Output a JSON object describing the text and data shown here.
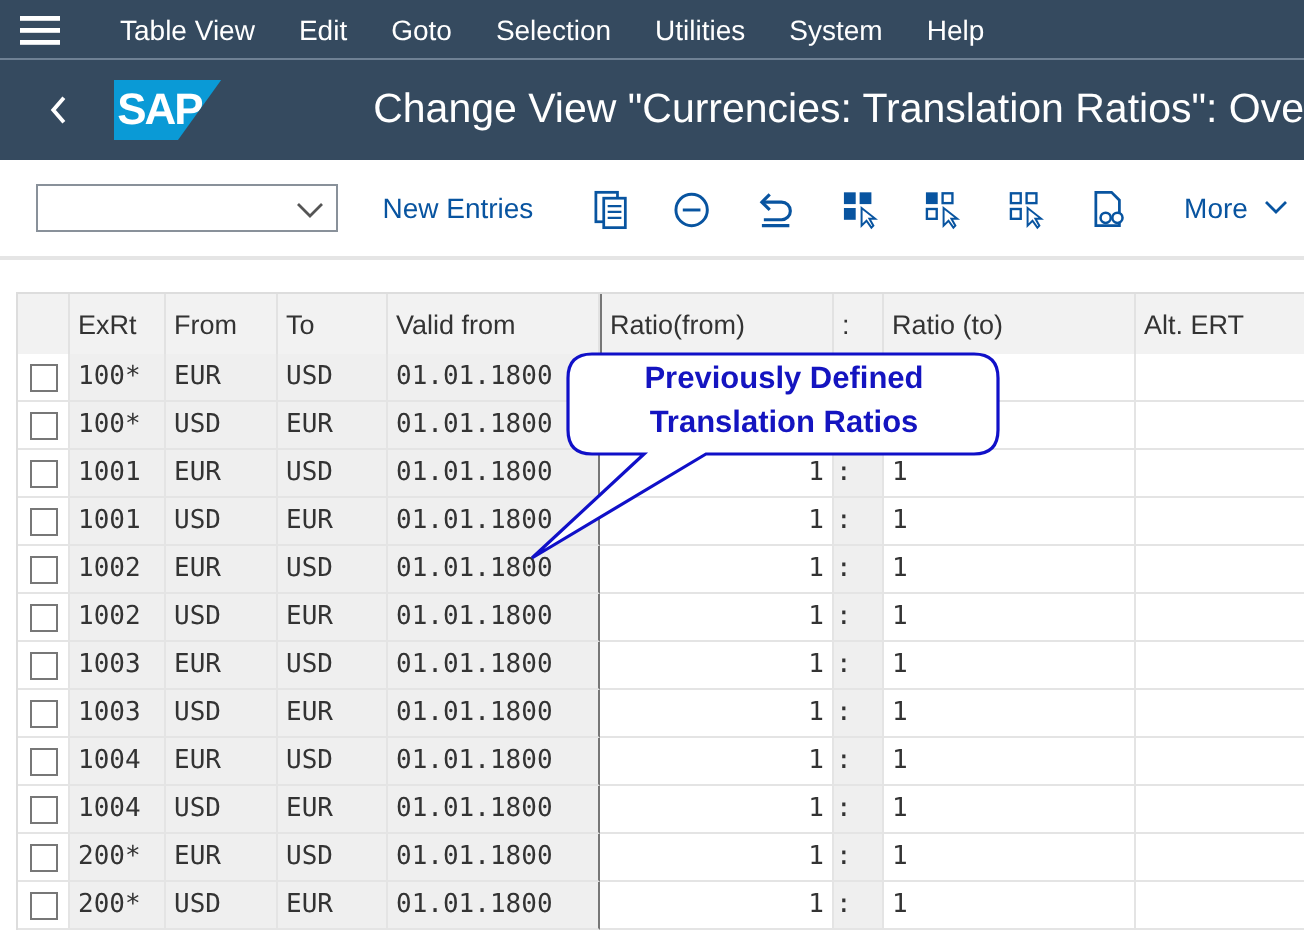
{
  "menu": [
    "Table View",
    "Edit",
    "Goto",
    "Selection",
    "Utilities",
    "System",
    "Help"
  ],
  "header": {
    "logo": "SAP",
    "title": "Change View \"Currencies: Translation Ratios\": Ove"
  },
  "toolbar": {
    "new_entries": "New Entries",
    "more": "More"
  },
  "table": {
    "columns": [
      "ExRt",
      "From",
      "To",
      "Valid from",
      "Ratio(from)",
      ":",
      "Ratio (to)",
      "Alt. ERT"
    ],
    "rows": [
      {
        "selected": false,
        "cells": [
          "100*",
          "EUR",
          "USD",
          "01.01.1800"
        ]
      },
      {
        "selected": false,
        "cells": [
          "100*",
          "USD",
          "EUR",
          "01.01.1800"
        ]
      },
      {
        "selected": false,
        "cells": [
          "1001",
          "EUR",
          "USD",
          "01.01.1800",
          "1",
          ":",
          "1"
        ]
      },
      {
        "selected": false,
        "cells": [
          "1001",
          "USD",
          "EUR",
          "01.01.1800",
          "1",
          ":",
          "1"
        ]
      },
      {
        "selected": false,
        "cells": [
          "1002",
          "EUR",
          "USD",
          "01.01.1800",
          "1",
          ":",
          "1"
        ]
      },
      {
        "selected": false,
        "cells": [
          "1002",
          "USD",
          "EUR",
          "01.01.1800",
          "1",
          ":",
          "1"
        ]
      },
      {
        "selected": false,
        "cells": [
          "1003",
          "EUR",
          "USD",
          "01.01.1800",
          "1",
          ":",
          "1"
        ]
      },
      {
        "selected": false,
        "cells": [
          "1003",
          "USD",
          "EUR",
          "01.01.1800",
          "1",
          ":",
          "1"
        ]
      },
      {
        "selected": false,
        "cells": [
          "1004",
          "EUR",
          "USD",
          "01.01.1800",
          "1",
          ":",
          "1"
        ]
      },
      {
        "selected": false,
        "cells": [
          "1004",
          "USD",
          "EUR",
          "01.01.1800",
          "1",
          ":",
          "1"
        ]
      },
      {
        "selected": false,
        "cells": [
          "200*",
          "EUR",
          "USD",
          "01.01.1800",
          "1",
          ":",
          "1"
        ]
      },
      {
        "selected": false,
        "cells": [
          "200*",
          "USD",
          "EUR",
          "01.01.1800",
          "1",
          ":",
          "1"
        ]
      }
    ]
  },
  "callout": {
    "text": "Previously Defined Translation Ratios"
  }
}
